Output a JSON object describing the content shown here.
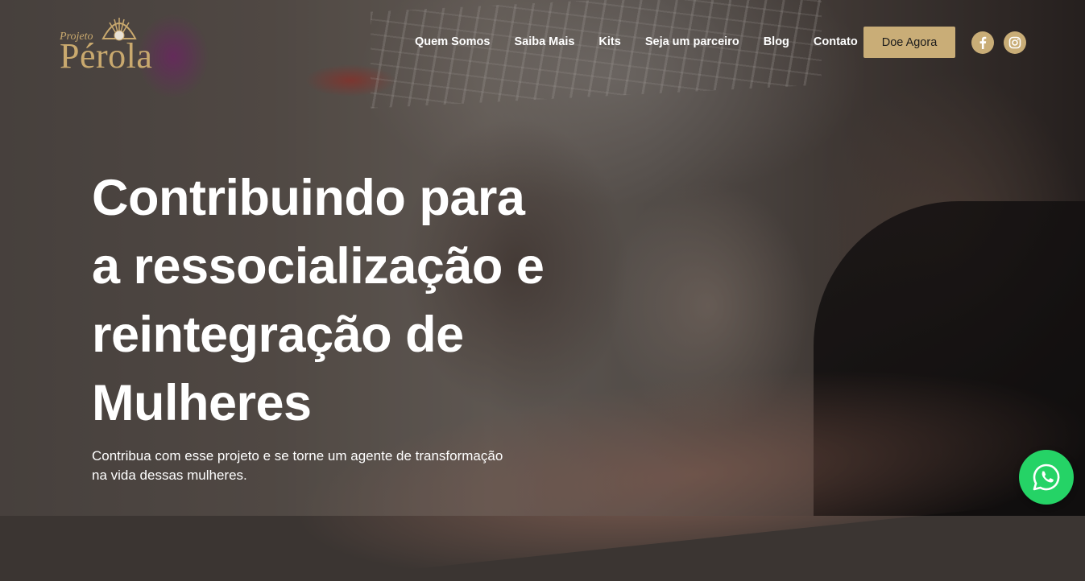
{
  "brand": {
    "small_text": "Projeto",
    "name": "Pérola",
    "accent_color": "#c9ad77"
  },
  "nav": {
    "items": [
      {
        "label": "Quem Somos"
      },
      {
        "label": "Saiba Mais"
      },
      {
        "label": "Kits"
      },
      {
        "label": "Seja um parceiro"
      },
      {
        "label": "Blog"
      },
      {
        "label": "Contato"
      }
    ],
    "donate_label": "Doe Agora"
  },
  "social": {
    "icons": [
      "facebook-icon",
      "instagram-icon"
    ]
  },
  "hero": {
    "title_lines": [
      "Contribuindo para",
      "a ressocialização e",
      "reintegração de",
      "Mulheres"
    ],
    "subtitle_lines": [
      "Contribua com esse projeto e se torne um agente de transformação",
      "na vida dessas mulheres."
    ]
  },
  "floating": {
    "icon": "whatsapp-icon",
    "color": "#25d366"
  }
}
